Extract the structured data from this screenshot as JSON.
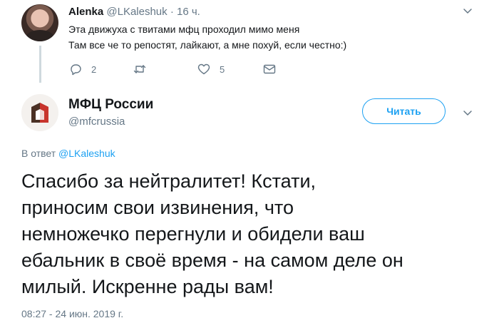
{
  "reply_parent": {
    "name": "Alenka",
    "handle": "@LKaleshuk",
    "dot": "·",
    "time": "16 ч.",
    "text_lines": [
      "Эта движуха с твитами мфц проходил мимо меня",
      "Там все че то репостят, лайкают, а мне похуй, если честно:)"
    ],
    "actions": {
      "reply_count": "2",
      "retweet_count": "",
      "like_count": "5"
    },
    "icons": [
      "reply-icon",
      "retweet-icon",
      "heart-icon",
      "message-icon",
      "chevron-down-icon"
    ]
  },
  "main_tweet": {
    "name": "МФЦ России",
    "handle": "@mfcrussia",
    "follow_label": "Читать",
    "reply_prefix": "В ответ",
    "reply_to_handle": "@LKaleshuk",
    "text_lines": [
      "Спасибо за нейтралитет! Кстати,",
      "приносим свои извинения, что",
      "немножечко перегнули и обидели ваш",
      "ебальник в своё время - на самом деле он",
      "милый. Искренне рады вам!"
    ],
    "timestamp": "08:27 - 24 июн. 2019 г."
  },
  "colors": {
    "accent": "#1da1f2",
    "secondary_text": "#657786",
    "primary_text": "#14171a",
    "logo_red": "#c8342c",
    "logo_brown": "#4a3024"
  }
}
